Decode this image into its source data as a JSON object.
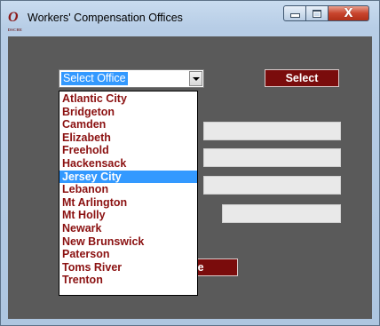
{
  "window": {
    "title": "Workers' Compensation Offices",
    "logo_glyph": "O",
    "logo_subtext": "DSCHE"
  },
  "titlebar_buttons": {
    "minimize": "minimize-icon",
    "maximize": "maximize-icon",
    "close_glyph": "X"
  },
  "form": {
    "office_select": {
      "value": "Select Office"
    },
    "select_button_label": "Select",
    "close_button_label": "ose"
  },
  "dropdown": {
    "items": [
      "Atlantic City",
      "Bridgeton",
      "Camden",
      "Elizabeth",
      "Freehold",
      "Hackensack",
      "Jersey City",
      "Lebanon",
      "Mt Arlington",
      "Mt Holly",
      "Newark",
      "New Brunswick",
      "Paterson",
      "Toms River",
      "Trenton"
    ],
    "highlighted_item": "Jersey City"
  },
  "colors": {
    "client_bg": "#5a5a5a",
    "accent_button": "#7a0c0c",
    "highlight": "#3399ff",
    "list_text": "#8b1111"
  }
}
